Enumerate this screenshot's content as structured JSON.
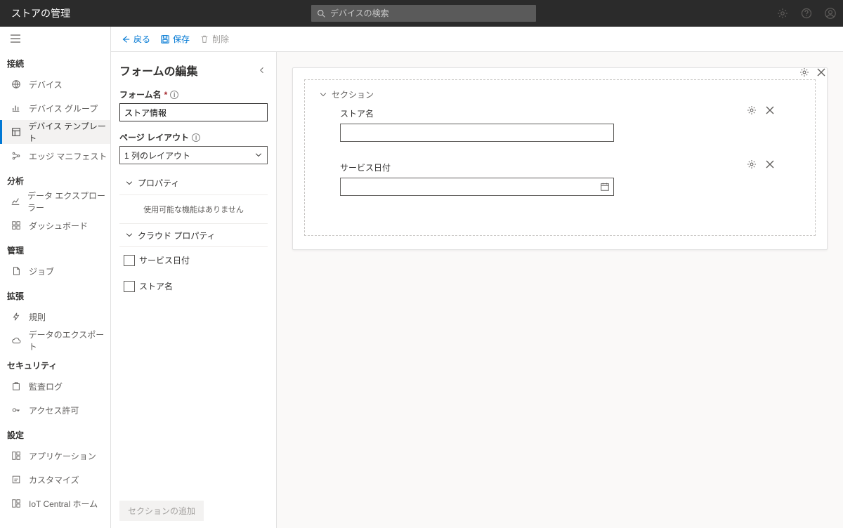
{
  "header": {
    "app_title": "ストアの管理",
    "search_placeholder": "デバイスの検索"
  },
  "nav": {
    "groups": [
      {
        "label": "接続",
        "items": [
          {
            "id": "devices",
            "label": "デバイス"
          },
          {
            "id": "device-groups",
            "label": "デバイス グループ"
          },
          {
            "id": "device-templates",
            "label": "デバイス テンプレート",
            "active": true
          },
          {
            "id": "edge-manifests",
            "label": "エッジ マニフェスト"
          }
        ]
      },
      {
        "label": "分析",
        "items": [
          {
            "id": "data-explorer",
            "label": "データ エクスプローラー"
          },
          {
            "id": "dashboards",
            "label": "ダッシュボード"
          }
        ]
      },
      {
        "label": "管理",
        "items": [
          {
            "id": "jobs",
            "label": "ジョブ"
          }
        ]
      },
      {
        "label": "拡張",
        "items": [
          {
            "id": "rules",
            "label": "規則"
          },
          {
            "id": "data-export",
            "label": "データのエクスポート"
          }
        ]
      },
      {
        "label": "セキュリティ",
        "items": [
          {
            "id": "audit-logs",
            "label": "監査ログ"
          },
          {
            "id": "permissions",
            "label": "アクセス許可"
          }
        ]
      },
      {
        "label": "設定",
        "items": [
          {
            "id": "application",
            "label": "アプリケーション"
          },
          {
            "id": "customize",
            "label": "カスタマイズ"
          },
          {
            "id": "iot-central-home",
            "label": "IoT Central ホーム"
          }
        ]
      }
    ]
  },
  "commands": {
    "back": "戻る",
    "save": "保存",
    "delete": "削除"
  },
  "panel": {
    "title": "フォームの編集",
    "form_name_label": "フォーム名",
    "form_name_value": "ストア情報",
    "page_layout_label": "ページ レイアウト",
    "page_layout_value": "1 列のレイアウト",
    "tree": {
      "properties_label": "プロパティ",
      "properties_empty": "使用可能な機能はありません",
      "cloud_properties_label": "クラウド プロパティ",
      "cloud_items": [
        {
          "label": "サービス日付"
        },
        {
          "label": "ストア名"
        }
      ]
    },
    "add_section": "セクションの追加"
  },
  "canvas": {
    "section_label": "セクション",
    "fields": [
      {
        "label": "ストア名",
        "type": "text"
      },
      {
        "label": "サービス日付",
        "type": "date"
      }
    ]
  }
}
